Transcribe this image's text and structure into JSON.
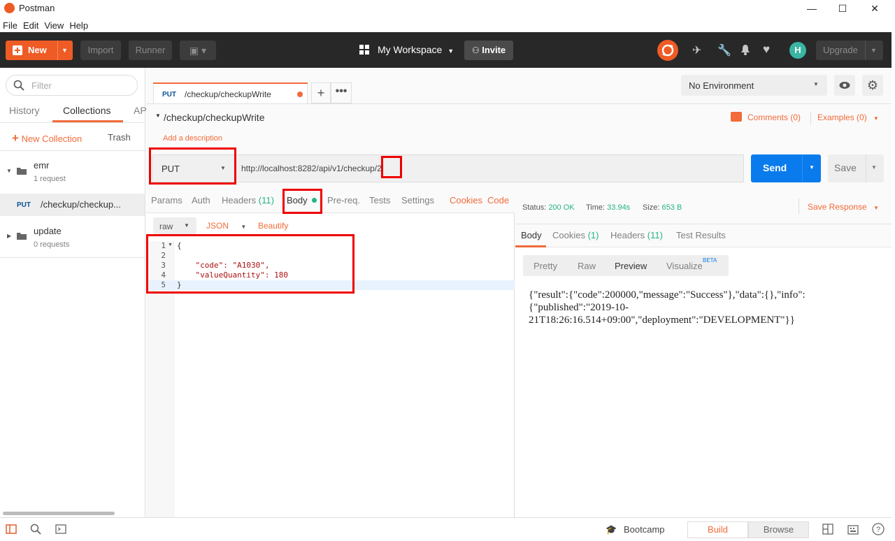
{
  "window": {
    "title": "Postman",
    "minimize": "—",
    "maximize": "☐",
    "close": "✕"
  },
  "menu": [
    "File",
    "Edit",
    "View",
    "Help"
  ],
  "header": {
    "new_label": "New",
    "import_label": "Import",
    "runner_label": "Runner",
    "workspace_label": "My Workspace",
    "invite_label": "Invite",
    "upgrade_label": "Upgrade",
    "avatar_initial": "H"
  },
  "sidebar": {
    "filter_placeholder": "Filter",
    "tabs": [
      "History",
      "Collections",
      "AP"
    ],
    "new_collection_label": "New Collection",
    "trash_label": "Trash",
    "collections": [
      {
        "name": "emr",
        "count": "1 request"
      },
      {
        "name": "update",
        "count": "0 requests"
      }
    ],
    "request": {
      "method": "PUT",
      "name": "/checkup/checkup..."
    }
  },
  "request_tab": {
    "method": "PUT",
    "name": "/checkup/checkupWrite"
  },
  "environment": {
    "selected": "No Environment"
  },
  "request": {
    "title": "/checkup/checkupWrite",
    "comments_label": "Comments (0)",
    "examples_label": "Examples (0)",
    "add_description": "Add a description",
    "method": "PUT",
    "url_prefix": "http://localhost:8282/api/v1/checku",
    "url_cursor_part": "p/2",
    "send_label": "Send",
    "save_label": "Save",
    "tabs": {
      "params": "Params",
      "auth": "Auth",
      "headers": "Headers",
      "headers_count": "(11)",
      "body": "Body",
      "prereq": "Pre-req.",
      "tests": "Tests",
      "settings": "Settings",
      "cookies": "Cookies",
      "code": "Code"
    },
    "body_mode": "raw",
    "body_format": "JSON",
    "beautify_label": "Beautify",
    "line_numbers": [
      "1",
      "2",
      "3",
      "4",
      "5"
    ],
    "body_lines": [
      "{",
      "",
      "    \"code\": \"A1030\",",
      "    \"valueQuantity\": 180",
      "}"
    ]
  },
  "response": {
    "status_label": "Status:",
    "status_value": "200 OK",
    "time_label": "Time:",
    "time_value": "33.94s",
    "size_label": "Size:",
    "size_value": "653 B",
    "save_response_label": "Save Response",
    "tabs": {
      "body": "Body",
      "cookies": "Cookies",
      "cookies_count": "(1)",
      "headers": "Headers",
      "headers_count": "(11)",
      "test_results": "Test Results"
    },
    "view_modes": [
      "Pretty",
      "Raw",
      "Preview",
      "Visualize"
    ],
    "beta_label": "BETA",
    "body_text_lines": [
      "{\"result\":{\"code\":200000,\"message\":\"Success\"},\"data\":{},\"info\":",
      "{\"published\":\"2019-10-",
      "21T18:26:16.514+09:00\",\"deployment\":\"DEVELOPMENT\"}}"
    ]
  },
  "footer": {
    "bootcamp_label": "Bootcamp",
    "build_label": "Build",
    "browse_label": "Browse"
  },
  "colors": {
    "accent": "#ef5b25",
    "send_blue": "#097bed",
    "status_green": "#26b47f",
    "highlight_red": "#e00000"
  }
}
